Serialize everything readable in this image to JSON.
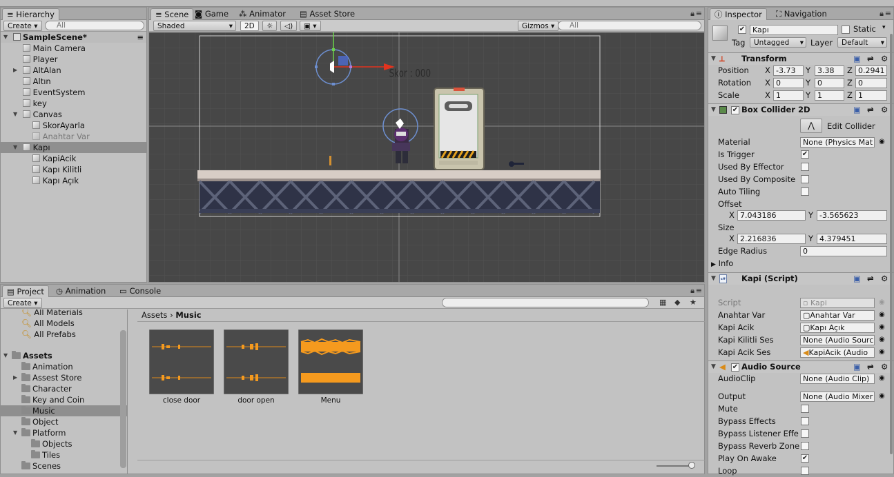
{
  "hierarchy": {
    "tab": "Hierarchy",
    "create": "Create",
    "search_placeholder": "All",
    "scene": "SampleScene*",
    "items": [
      "Main Camera",
      "Player",
      "AltAlan",
      "Altın",
      "EventSystem",
      "key",
      "Canvas",
      "SkorAyarla",
      "Anahtar Var",
      "Kapı",
      "KapiAcik",
      "Kapı Kilitli",
      "Kapı Açık"
    ]
  },
  "scene_view": {
    "tabs": [
      "Scene",
      "Game",
      "Animator",
      "Asset Store"
    ],
    "shading": "Shaded",
    "mode_2d": "2D",
    "gizmos": "Gizmos",
    "search_placeholder": "All",
    "score_text": "Skor : 000"
  },
  "project": {
    "tabs": [
      "Project",
      "Animation",
      "Console"
    ],
    "create": "Create",
    "favorites": [
      "All Materials",
      "All Models",
      "All Prefabs"
    ],
    "assets_root": "Assets",
    "folders": [
      "Animation",
      "Assest Store",
      "Character",
      "Key and Coin",
      "Music",
      "Object",
      "Platform",
      "Objects",
      "Tiles",
      "Scenes"
    ],
    "breadcrumb": [
      "Assets",
      "Music"
    ],
    "files": [
      "close door",
      "door open",
      "Menu"
    ]
  },
  "inspector": {
    "tabs": [
      "Inspector",
      "Navigation"
    ],
    "name": "Kapı",
    "static_label": "Static",
    "tag_label": "Tag",
    "tag_value": "Untagged",
    "layer_label": "Layer",
    "layer_value": "Default",
    "transform": {
      "title": "Transform",
      "position_label": "Position",
      "position": [
        "-3.73",
        "3.38",
        "0.2941"
      ],
      "rotation_label": "Rotation",
      "rotation": [
        "0",
        "0",
        "0"
      ],
      "scale_label": "Scale",
      "scale": [
        "1",
        "1",
        "1"
      ]
    },
    "box_collider": {
      "title": "Box Collider 2D",
      "edit_collider": "Edit Collider",
      "material_label": "Material",
      "material": "None (Physics Mat",
      "is_trigger": "Is Trigger",
      "used_by_effector": "Used By Effector",
      "used_by_composite": "Used By Composite",
      "auto_tiling": "Auto Tiling",
      "offset_label": "Offset",
      "offset_x": "7.043186",
      "offset_y": "-3.565623",
      "size_label": "Size",
      "size_x": "2.216836",
      "size_y": "4.379451",
      "edge_radius_label": "Edge Radius",
      "edge_radius": "0",
      "info": "Info"
    },
    "script": {
      "title": "Kapi (Script)",
      "script_label": "Script",
      "script_value": "Kapi",
      "anahtar_var_label": "Anahtar Var",
      "anahtar_var_value": "Anahtar Var",
      "kapi_acik_label": "Kapi Acik",
      "kapi_acik_value": "Kapı Açık",
      "kilitli_ses_label": "Kapi Kilitli Ses",
      "kilitli_ses_value": "None (Audio Sourc",
      "acik_ses_label": "Kapi Acik Ses",
      "acik_ses_value": "KapiAcik (Audio"
    },
    "audio": {
      "title": "Audio Source",
      "clip_label": "AudioClip",
      "clip_value": "None (Audio Clip)",
      "output_label": "Output",
      "output_value": "None (Audio Mixer",
      "mute": "Mute",
      "bypass_effects": "Bypass Effects",
      "bypass_listener": "Bypass Listener Effe",
      "bypass_reverb": "Bypass Reverb Zone",
      "play_on_awake": "Play On Awake",
      "loop": "Loop"
    }
  },
  "axis_labels": {
    "x": "X",
    "y": "Y",
    "z": "Z"
  }
}
